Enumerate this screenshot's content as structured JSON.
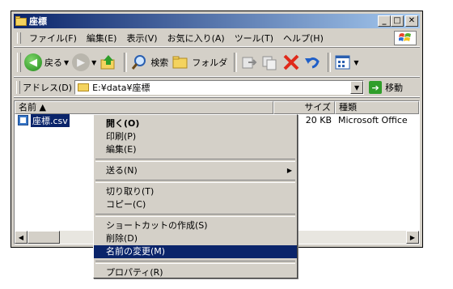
{
  "window": {
    "title": "座標"
  },
  "menubar": {
    "items": [
      "ファイル(F)",
      "編集(E)",
      "表示(V)",
      "お気に入り(A)",
      "ツール(T)",
      "ヘルプ(H)"
    ]
  },
  "toolbar": {
    "back_label": "戻る",
    "search_label": "検索",
    "folders_label": "フォルダ"
  },
  "address": {
    "label": "アドレス(D)",
    "path": "E:¥data¥座標",
    "go_label": "移動"
  },
  "columns": {
    "name": "名前 ▲",
    "size": "サイズ",
    "type": "種類"
  },
  "files": [
    {
      "name": "座標.csv",
      "size": "20 KB",
      "type": "Microsoft Office"
    }
  ],
  "context_menu": {
    "open": "開く(O)",
    "print": "印刷(P)",
    "edit": "編集(E)",
    "send_to": "送る(N)",
    "cut": "切り取り(T)",
    "copy": "コピー(C)",
    "create_shortcut": "ショートカットの作成(S)",
    "delete": "削除(D)",
    "rename": "名前の変更(M)",
    "properties": "プロパティ(R)"
  },
  "colors": {
    "titlebar_start": "#0a246a",
    "titlebar_end": "#a6caf0",
    "selection": "#0a246a",
    "face": "#d4d0c8"
  },
  "icons": [
    "folder-icon",
    "back-arrow-icon",
    "forward-arrow-icon",
    "up-folder-icon",
    "search-icon",
    "folders-icon",
    "move-to-icon",
    "copy-to-icon",
    "delete-icon",
    "undo-icon",
    "views-icon",
    "csv-file-icon",
    "go-arrow-icon",
    "windows-logo-icon"
  ]
}
